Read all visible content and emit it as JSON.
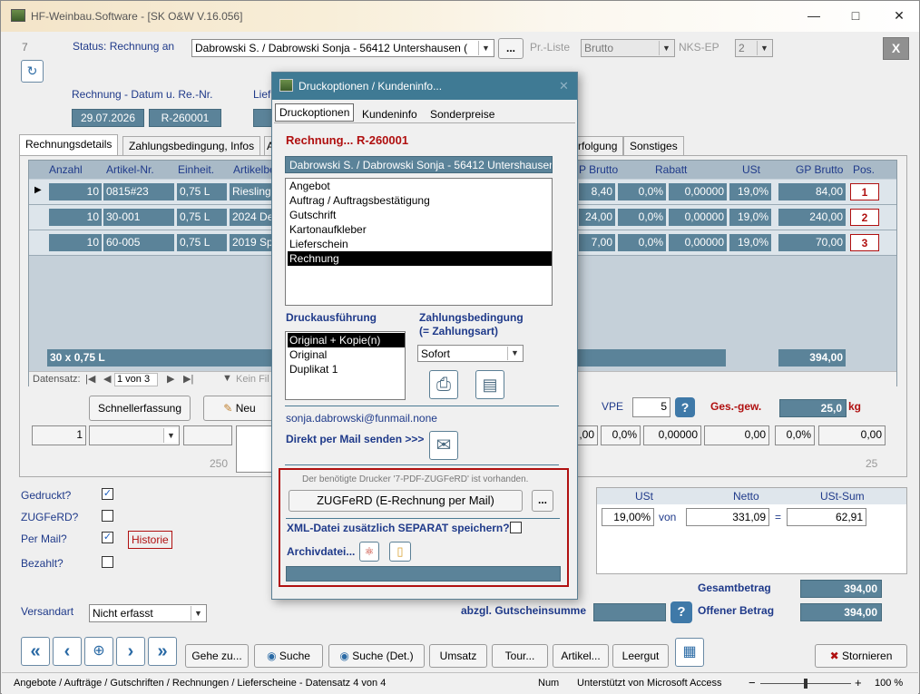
{
  "window": {
    "title": "HF-Weinbau.Software - [SK O&W V.16.056]"
  },
  "header": {
    "record_no": "7",
    "status_label": "Status: Rechnung an",
    "customer": "Dabrowski S. / Dabrowski Sonja - 56412 Untershausen (",
    "ellipsis": "...",
    "preisliste_label": "Pr.-Liste",
    "preisliste_value": "Brutto",
    "nks_label": "NKS-EP",
    "nks_value": "2",
    "close": "X",
    "date_label": "Rechnung - Datum u. Re.-Nr.",
    "lief_label": "Lief",
    "date": "29.07.2026",
    "invoice_no": "R-260001"
  },
  "tabs": [
    "Rechnungsdetails",
    "Zahlungsbedingung, Infos",
    "A",
    "rfolgung",
    "Sonstiges"
  ],
  "grid": {
    "headers": [
      "Anzahl",
      "Artikel-Nr.",
      "Einheit.",
      "Artikelbe",
      "P Brutto",
      "Rabatt",
      "USt",
      "GP Brutto",
      "Pos."
    ],
    "rows": [
      {
        "anzahl": "10",
        "artikel": "0815#23",
        "einheit": "0,75 L",
        "bez": "Riesling",
        "ep": "8,40",
        "rab1": "0,0%",
        "rab2": "0,00000",
        "ust": "19,0%",
        "gp": "84,00",
        "pos": "1"
      },
      {
        "anzahl": "10",
        "artikel": "30-001",
        "einheit": "0,75 L",
        "bez": "2024 De",
        "ep": "24,00",
        "rab1": "0,0%",
        "rab2": "0,00000",
        "ust": "19,0%",
        "gp": "240,00",
        "pos": "2"
      },
      {
        "anzahl": "10",
        "artikel": "60-005",
        "einheit": "0,75 L",
        "bez": "2019 Sp",
        "ep": "7,00",
        "rab1": "0,0%",
        "rab2": "0,00000",
        "ust": "19,0%",
        "gp": "70,00",
        "pos": "3"
      }
    ],
    "footer_left": "30 x 0,75 L",
    "footer_total": "394,00",
    "nav_label": "Datensatz:",
    "nav_pos": "1 von 3",
    "filter": "Kein Fil"
  },
  "below_grid": {
    "schnell": "Schnellerfassung",
    "neu": "Neu",
    "vpe_label": "VPE",
    "vpe_value": "5",
    "help": "?",
    "gesgew_label": "Ges.-gew.",
    "gesgew_value": "25,0",
    "kg": "kg",
    "qty": "1",
    "n250": "250",
    "n25": "25",
    "e1": ",00",
    "e2": "0,0%",
    "e3": "0,00000",
    "e4": "0,00",
    "e5": "0,0%",
    "e6": "0,00"
  },
  "flags": {
    "gedruckt": "Gedruckt?",
    "zugferd": "ZUGFeRD?",
    "permail": "Per Mail?",
    "bezahlt": "Bezahlt?",
    "historie": "Historie",
    "versandart_label": "Versandart",
    "versandart_value": "Nicht erfasst"
  },
  "tax": {
    "h_ust": "USt",
    "h_netto": "Netto",
    "h_sum": "USt-Sum",
    "rate": "19,00%",
    "von": "von",
    "netto": "331,09",
    "eq": "=",
    "sum": "62,91"
  },
  "totals": {
    "gesamt_label": "Gesamtbetrag",
    "gesamt": "394,00",
    "gutschein_label": "abzgl. Gutscheinsumme",
    "offen_label": "Offener Betrag",
    "offen": "394,00"
  },
  "toolbar": {
    "gehe": "Gehe zu...",
    "suche": "Suche",
    "suche_det": "Suche (Det.)",
    "umsatz": "Umsatz",
    "tour": "Tour...",
    "artikel": "Artikel...",
    "leergut": "Leergut",
    "stornieren": "Stornieren"
  },
  "statusbar": {
    "text": "Angebote / Aufträge / Gutschriften / Rechnungen / Lieferscheine - Datensatz 4 von 4",
    "num": "Num",
    "ms": "Unterstützt von Microsoft Access",
    "zoom": "100 %"
  },
  "dialog": {
    "title": "Druckoptionen / Kundeninfo...",
    "tabs": [
      "Druckoptionen",
      "Kundeninfo",
      "Sonderpreise"
    ],
    "heading": "Rechnung... R-260001",
    "customer": "Dabrowski S. / Dabrowski Sonja - 56412 Untershausen",
    "doc_types": [
      "Angebot",
      "Auftrag / Auftragsbestätigung",
      "Gutschrift",
      "Kartonaufkleber",
      "Lieferschein",
      "Rechnung"
    ],
    "druck_label": "Druckausführung",
    "druck_options": [
      "Original + Kopie(n)",
      "Original",
      "Duplikat 1"
    ],
    "zahl_label": "Zahlungsbedingung",
    "zahl_sub": "(= Zahlungsart)",
    "zahl_value": "Sofort",
    "email": "sonja.dabrowski@funmail.none",
    "mail_label": "Direkt per Mail senden >>>",
    "printer_note": "Der benötigte Drucker '7-PDF-ZUGFeRD' ist vorhanden.",
    "zugferd_btn": "ZUGFeRD (E-Rechnung per Mail)",
    "more": "...",
    "xml_label": "XML-Datei zusätzlich SEPARAT speichern?",
    "archiv_label": "Archivdatei..."
  }
}
